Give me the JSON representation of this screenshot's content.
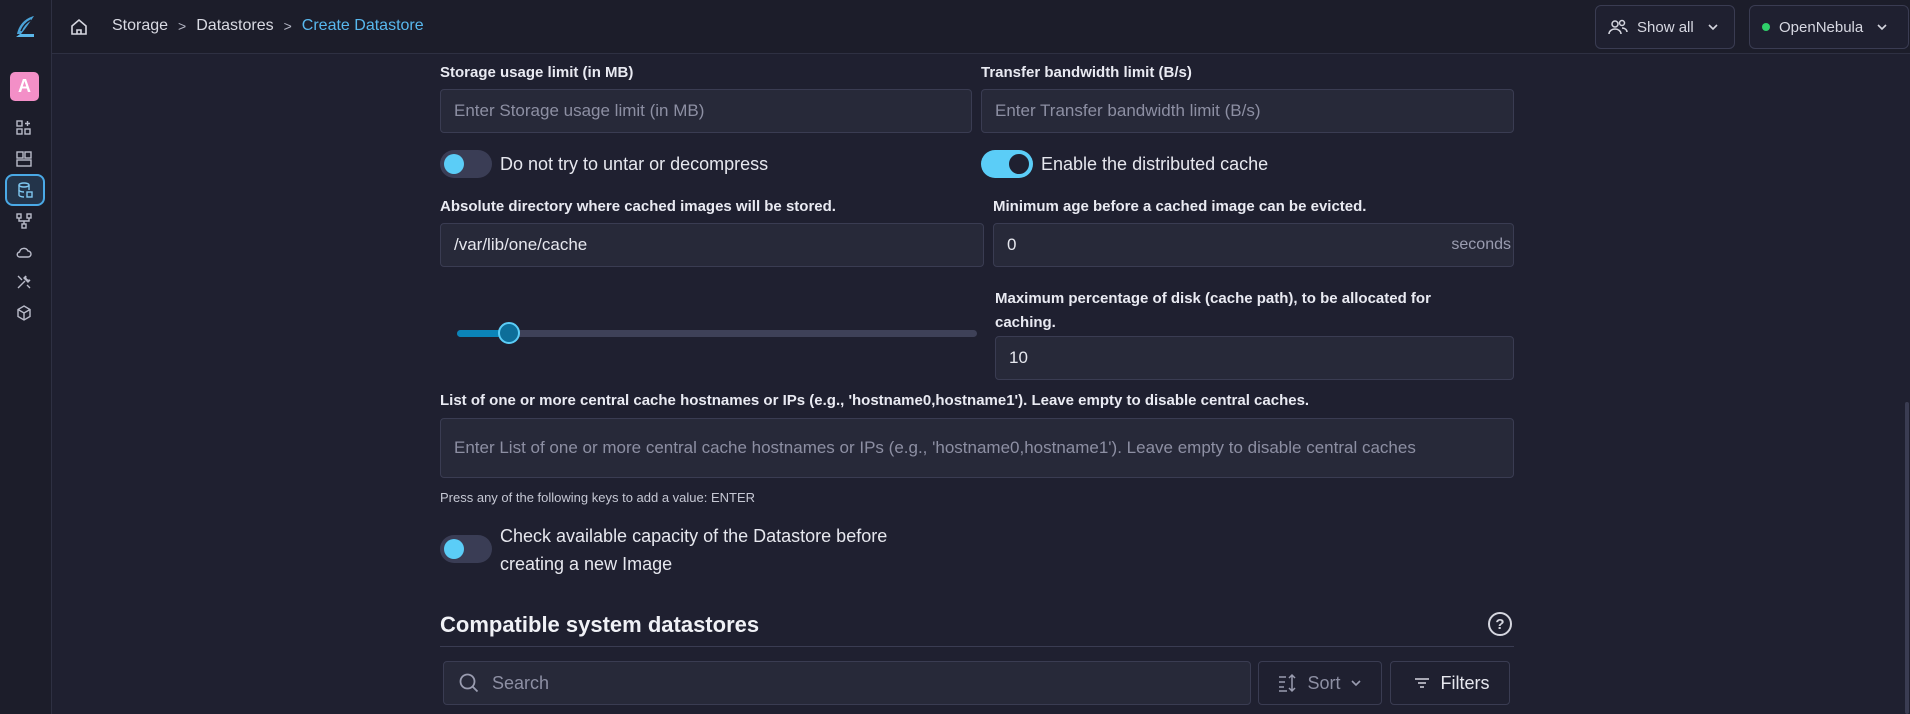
{
  "sidebar": {
    "avatar_letter": "A",
    "icons": [
      "apps-add-icon",
      "dashboard-icon",
      "storage-icon",
      "network-icon",
      "cloud-icon",
      "tools-icon",
      "cube-icon"
    ]
  },
  "breadcrumb": {
    "items": [
      "Storage",
      "Datastores"
    ],
    "current": "Create Datastore"
  },
  "topbar": {
    "show_all": "Show all",
    "zone": "OpenNebula",
    "zone_status_color": "#2fcf6a"
  },
  "form": {
    "storage_limit": {
      "label": "Storage usage limit (in MB)",
      "placeholder": "Enter Storage usage limit (in MB)"
    },
    "bandwidth_limit": {
      "label": "Transfer bandwidth limit (B/s)",
      "placeholder": "Enter Transfer bandwidth limit (B/s)"
    },
    "no_decompress": {
      "label": "Do not try to untar or decompress",
      "checked": false
    },
    "distributed_cache": {
      "label": "Enable the distributed cache",
      "checked": true
    },
    "cache_dir": {
      "label": "Absolute directory where cached images will be stored.",
      "value": "/var/lib/one/cache"
    },
    "min_age": {
      "label": "Minimum age before a cached image can be evicted.",
      "value": "0",
      "unit": "seconds"
    },
    "max_percentage": {
      "label": "Maximum percentage of disk (cache path), to be allocated for caching.",
      "value": "10",
      "slider_fraction": 0.1
    },
    "central_caches": {
      "label": "List of one or more central cache hostnames or IPs (e.g., 'hostname0,hostname1'). Leave empty to disable central caches.",
      "placeholder": "Enter List of one or more central cache hostnames or IPs (e.g., 'hostname0,hostname1'). Leave empty to disable central caches",
      "helper": "Press any of the following keys to add a value: ENTER"
    },
    "check_capacity": {
      "label_line1": "Check available capacity of the Datastore before",
      "label_line2": "creating a new Image",
      "checked": false
    }
  },
  "compatible": {
    "title": "Compatible system datastores",
    "search_placeholder": "Search",
    "sort_label": "Sort",
    "filters_label": "Filters"
  },
  "colors": {
    "accent": "#5bcdf7",
    "breadcrumb_current": "#58b8ee",
    "avatar": "#f38fc7"
  }
}
